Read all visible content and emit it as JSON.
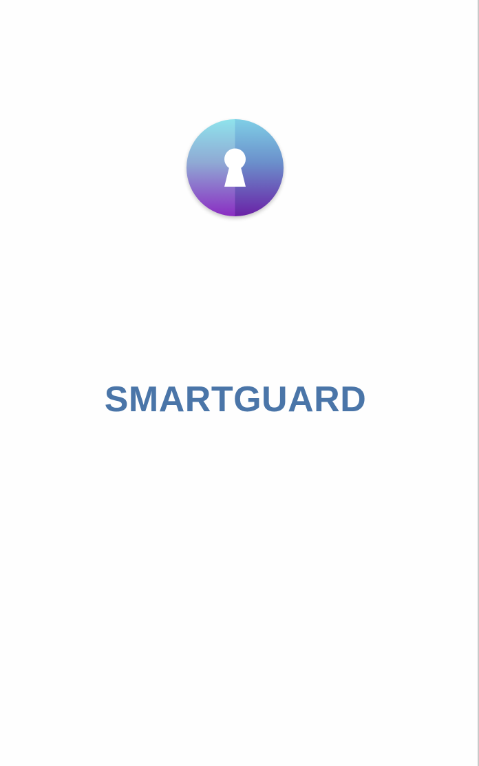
{
  "splash": {
    "app_name": "SMARTGUARD",
    "logo_icon": "keyhole-icon",
    "colors": {
      "title": "#4a75a8",
      "gradient_top": "#8fe0ea",
      "gradient_bottom": "#8a2cc2",
      "keyhole": "#ffffff",
      "background": "#fefefe"
    }
  }
}
